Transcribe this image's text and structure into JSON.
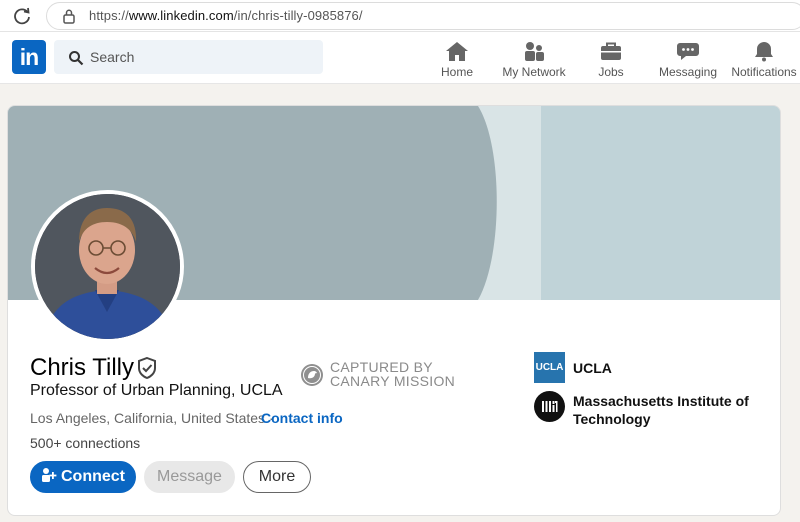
{
  "browser": {
    "url_prefix": "https://",
    "url_host": "www.linkedin.com",
    "url_path": "/in/chris-tilly-0985876/"
  },
  "header": {
    "logo_text": "in",
    "search_placeholder": "Search",
    "nav": [
      {
        "label": "Home",
        "icon": "home-icon"
      },
      {
        "label": "My Network",
        "icon": "network-icon"
      },
      {
        "label": "Jobs",
        "icon": "briefcase-icon"
      },
      {
        "label": "Messaging",
        "icon": "chat-icon"
      },
      {
        "label": "Notifications",
        "icon": "bell-icon"
      }
    ]
  },
  "profile": {
    "name": "Chris Tilly",
    "headline": "Professor of Urban Planning, UCLA",
    "location": "Los Angeles, California, United States ·",
    "contact_label": "Contact info",
    "connections": "500+ connections",
    "buttons": {
      "connect": "Connect",
      "message": "Message",
      "more": "More"
    }
  },
  "stamp": {
    "line1": "CAPTURED BY",
    "line2": "CANARY MISSION"
  },
  "organizations": [
    {
      "logo_text": "UCLA",
      "name": "UCLA"
    },
    {
      "logo_text": "MIT",
      "name": "Massachusetts Institute of Technology"
    }
  ],
  "colors": {
    "brand": "#0a66c2",
    "banner_dark": "#9fb0b5",
    "banner_light": "#c0d3d8",
    "ucla_blue": "#2774ae"
  }
}
